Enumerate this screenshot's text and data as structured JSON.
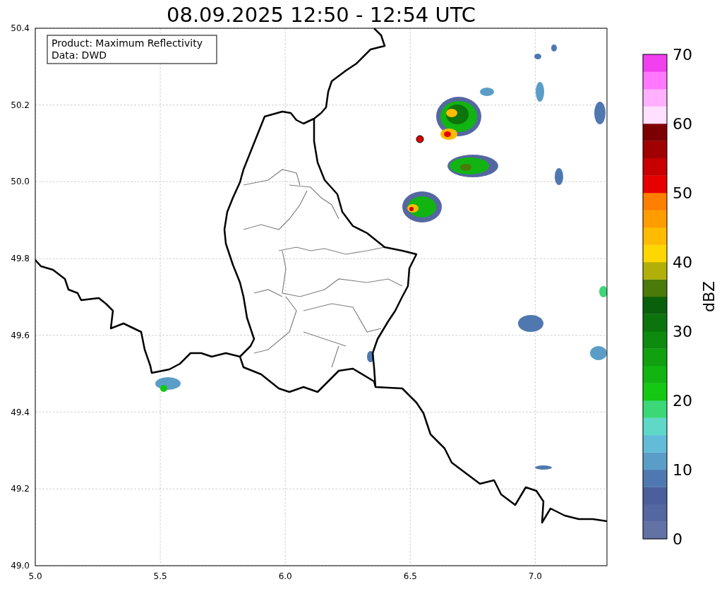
{
  "title": "08.09.2025 12:50 - 12:54 UTC",
  "legend": [
    "Product: Maximum Reflectivity",
    "Data: DWD"
  ],
  "x_axis": {
    "ticks": [
      "5.0",
      "5.5",
      "6.0",
      "6.5",
      "7.0"
    ]
  },
  "y_axis": {
    "ticks": [
      "50.4",
      "50.2",
      "50.0",
      "49.8",
      "49.6",
      "49.4",
      "49.2",
      "49.0"
    ]
  },
  "colorbar": {
    "label": "dBZ",
    "ticks": [
      "70",
      "60",
      "50",
      "40",
      "30",
      "20",
      "10",
      "0"
    ],
    "segments": [
      {
        "color": "#6272a4"
      },
      {
        "color": "#5567a0"
      },
      {
        "color": "#4a5f9c"
      },
      {
        "color": "#4f78b0"
      },
      {
        "color": "#5a9ec8"
      },
      {
        "color": "#62bcd8"
      },
      {
        "color": "#60d8c8"
      },
      {
        "color": "#3cd878"
      },
      {
        "color": "#14c814"
      },
      {
        "color": "#12b412"
      },
      {
        "color": "#10a010"
      },
      {
        "color": "#0e8a0e"
      },
      {
        "color": "#0c740c"
      },
      {
        "color": "#0a600a"
      },
      {
        "color": "#4a7a0a"
      },
      {
        "color": "#b0b008"
      },
      {
        "color": "#ffd700"
      },
      {
        "color": "#ffbb00"
      },
      {
        "color": "#ff9c00"
      },
      {
        "color": "#ff7f00"
      },
      {
        "color": "#e60000"
      },
      {
        "color": "#c80000"
      },
      {
        "color": "#a00000"
      },
      {
        "color": "#7d0000"
      },
      {
        "color": "#ffe0ff"
      },
      {
        "color": "#ffb0ff"
      },
      {
        "color": "#ff78ff"
      },
      {
        "color": "#f040f0"
      }
    ]
  }
}
